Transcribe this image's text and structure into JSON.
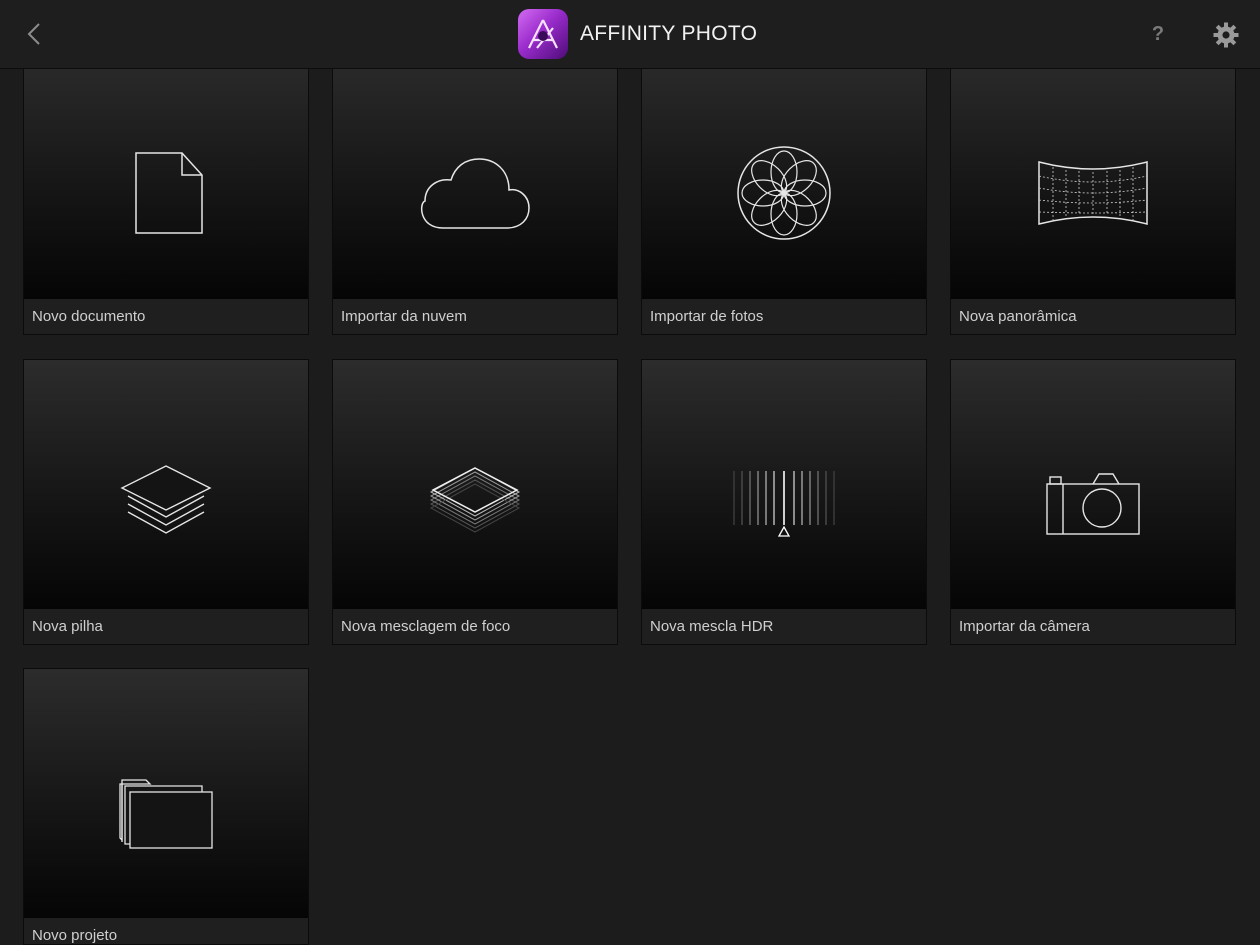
{
  "header": {
    "title": "AFFINITY PHOTO",
    "help_label": "?"
  },
  "tiles": [
    {
      "label": "Novo documento",
      "icon": "document-icon"
    },
    {
      "label": "Importar da nuvem",
      "icon": "cloud-icon"
    },
    {
      "label": "Importar de fotos",
      "icon": "photos-flower-icon"
    },
    {
      "label": "Nova panorâmica",
      "icon": "panorama-icon"
    },
    {
      "label": "Nova pilha",
      "icon": "layer-stack-icon"
    },
    {
      "label": "Nova mesclagem de foco",
      "icon": "focus-merge-icon"
    },
    {
      "label": "Nova mescla HDR",
      "icon": "hdr-icon"
    },
    {
      "label": "Importar da câmera",
      "icon": "camera-icon"
    },
    {
      "label": "Novo projeto",
      "icon": "folder-icon"
    }
  ],
  "colors": {
    "background": "#1c1c1c",
    "logo_accent": "#9a2ccc",
    "icon_stroke": "#e6e6e6"
  }
}
